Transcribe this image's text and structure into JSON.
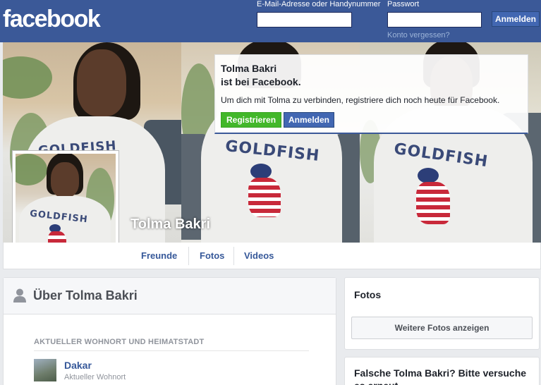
{
  "header": {
    "logo": "facebook",
    "email_label": "E-Mail-Adresse oder Handynummer",
    "password_label": "Passwort",
    "login_button": "Anmelden",
    "forgot_link": "Konto vergessen?"
  },
  "profile": {
    "name": "Tolma Bakri"
  },
  "join_card": {
    "name_line": "Tolma Bakri",
    "title_rest": "ist bei Facebook.",
    "text": "Um dich mit Tolma zu verbinden, registriere dich noch heute für Facebook.",
    "register_button": "Registrieren",
    "login_button": "Anmelden"
  },
  "tabs": [
    {
      "label": "Freunde"
    },
    {
      "label": "Fotos"
    },
    {
      "label": "Videos"
    }
  ],
  "about": {
    "title": "Über Tolma Bakri",
    "section_label": "AKTUELLER WOHNORT UND HEIMATSTADT",
    "place_name": "Dakar",
    "place_sub": "Aktueller Wohnort"
  },
  "photos": {
    "title": "Fotos",
    "more_button": "Weitere Fotos anzeigen"
  },
  "fake_card": {
    "title": "Falsche Tolma Bakri? Bitte versuche es erneut"
  },
  "shirt_text": "GOLDFISH",
  "colors": {
    "brand": "#3b5998",
    "button_blue": "#4267b2",
    "button_green": "#42b72a",
    "link": "#365899",
    "background": "#e9ebee"
  }
}
